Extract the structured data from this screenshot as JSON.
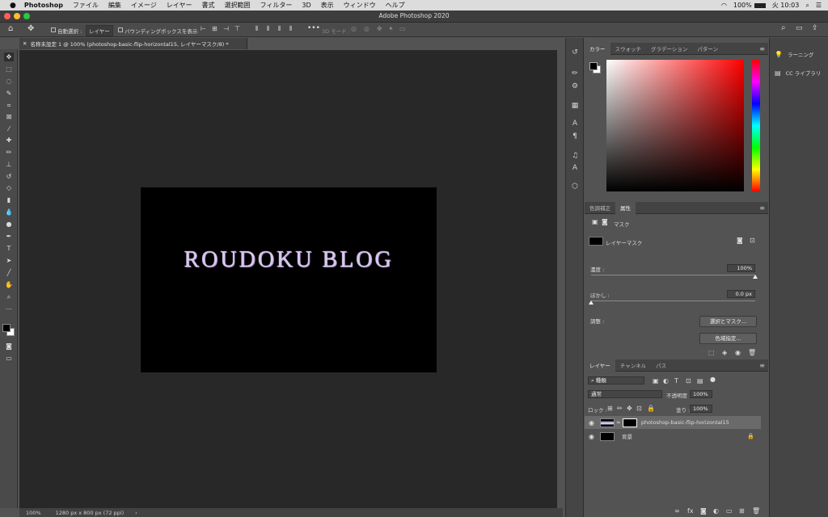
{
  "menubar": {
    "app": "Photoshop",
    "items": [
      "ファイル",
      "編集",
      "イメージ",
      "レイヤー",
      "書式",
      "選択範囲",
      "フィルター",
      "3D",
      "表示",
      "ウィンドウ",
      "ヘルプ"
    ],
    "battery": "100%",
    "clock": "火 10:03"
  },
  "titlebar": {
    "title": "Adobe Photoshop 2020"
  },
  "options": {
    "auto_select_label": "自動選択 :",
    "auto_select_value": "レイヤー",
    "bounding_box_label": "バウンディングボックスを表示",
    "mode3d_label": "3D モード :"
  },
  "document": {
    "tab_label": "名称未設定 1 @ 100% (photoshop-basic-flip-horizontal15, レイヤーマスク/8) *",
    "text": "ROUDOKU BLOG"
  },
  "status": {
    "zoom": "100%",
    "doc_info": "1280 px x 800 px (72 ppi)"
  },
  "color_panel": {
    "tabs": [
      "カラー",
      "スウォッチ",
      "グラデーション",
      "パターン"
    ],
    "hue_color": "#ff0000"
  },
  "properties_panel": {
    "tabs": [
      "色調補正",
      "属性"
    ],
    "mask_label": "マスク",
    "layer_mask_label": "レイヤーマスク",
    "density_label": "濃度 :",
    "density_value": "100%",
    "density_level": 1.0,
    "feather_label": "ぼかし :",
    "feather_value": "0.0 px",
    "feather_level": 0.0,
    "adjust_label": "調整 :",
    "select_mask_button": "選択とマスク...",
    "color_range_button": "色域指定..."
  },
  "layers_panel": {
    "tabs": [
      "レイヤー",
      "チャンネル",
      "パス"
    ],
    "filter_kind": "種類",
    "blend_mode": "通常",
    "opacity_label": "不透明度 :",
    "opacity_value": "100%",
    "lock_label": "ロック :",
    "fill_label": "塗り :",
    "fill_value": "100%",
    "layers": [
      {
        "name": "photoshop-basic-flip-horizontal15"
      },
      {
        "name": "背景"
      }
    ]
  },
  "far_panel": {
    "learn_label": "ラーニング",
    "libraries_label": "CC ライブラリ"
  }
}
